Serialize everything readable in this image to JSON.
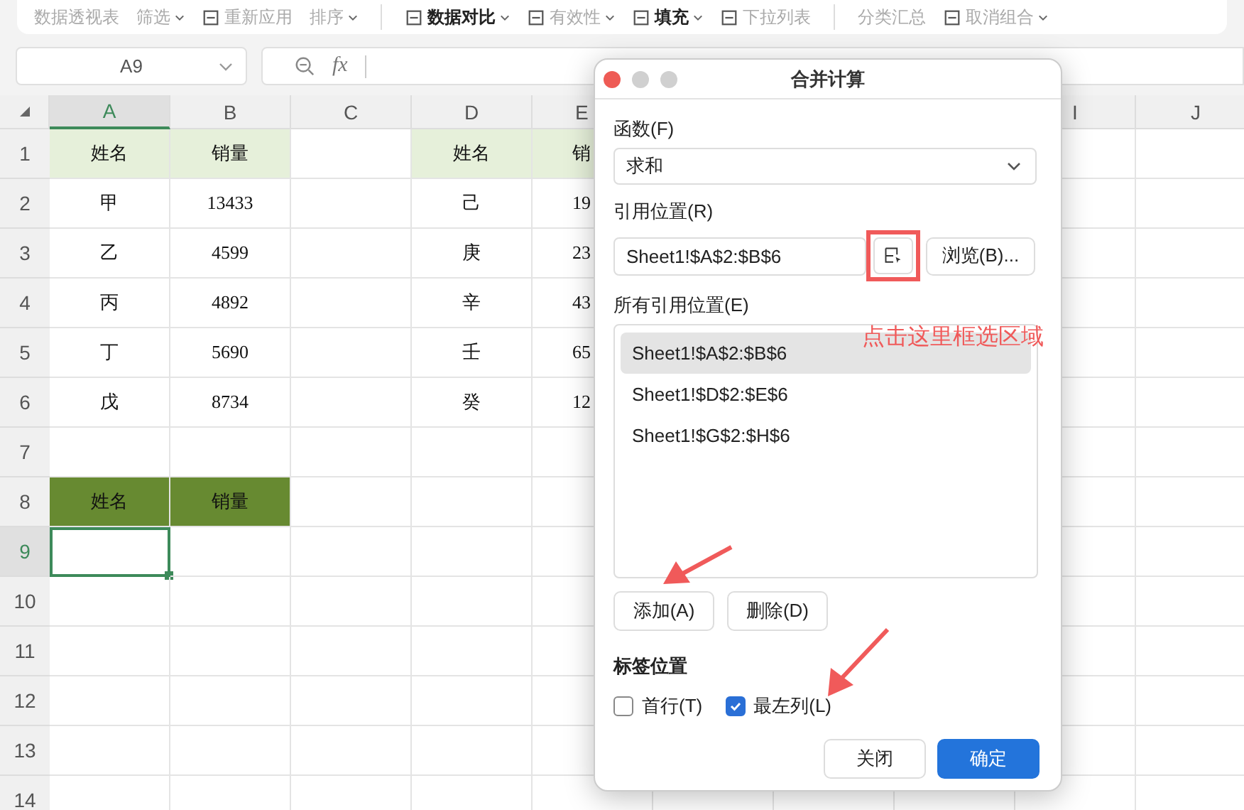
{
  "toolbar": {
    "groups": [
      [
        {
          "label": "数据透视表",
          "kind": "text",
          "dropdown": false
        },
        {
          "label": "筛选",
          "kind": "text",
          "dropdown": true
        },
        {
          "label": "重新应用",
          "kind": "icon",
          "dropdown": false
        },
        {
          "label": "排序",
          "kind": "text",
          "dropdown": true
        }
      ],
      [
        {
          "label": "数据对比",
          "kind": "icon",
          "dropdown": true,
          "bold": true
        },
        {
          "label": "有效性",
          "kind": "icon",
          "dropdown": true,
          "bold": false
        },
        {
          "label": "填充",
          "kind": "icon",
          "dropdown": true,
          "bold": true
        },
        {
          "label": "下拉列表",
          "kind": "icon",
          "dropdown": false,
          "bold": false
        }
      ],
      [
        {
          "label": "分类汇总",
          "kind": "text",
          "dropdown": false
        },
        {
          "label": "取消组合",
          "kind": "icon",
          "dropdown": true
        }
      ]
    ]
  },
  "formula_bar": {
    "name_box": "A9",
    "fx": "fx"
  },
  "sheet": {
    "columns": [
      {
        "label": "A",
        "selected": true
      },
      {
        "label": "B",
        "selected": false
      },
      {
        "label": "C",
        "selected": false
      },
      {
        "label": "D",
        "selected": false
      },
      {
        "label": "E",
        "selected": false
      },
      {},
      {},
      {},
      {
        "label": "I",
        "selected": false
      },
      {
        "label": "J",
        "selected": false
      }
    ],
    "rows": [
      {
        "label": "1",
        "selected": false,
        "cells": [
          {
            "text": "姓名",
            "color": "#e6f0da"
          },
          {
            "text": "销量",
            "color": "#e6f0da"
          },
          {
            "text": ""
          },
          {
            "text": "姓名",
            "color": "#e6f0da"
          },
          {
            "text": "销",
            "color": "#e6f0da"
          }
        ]
      },
      {
        "label": "2",
        "selected": false,
        "cells": [
          {
            "text": "甲"
          },
          {
            "text": "13433"
          },
          {
            "text": ""
          },
          {
            "text": "己"
          },
          {
            "text": "19"
          }
        ]
      },
      {
        "label": "3",
        "selected": false,
        "cells": [
          {
            "text": "乙"
          },
          {
            "text": "4599"
          },
          {
            "text": ""
          },
          {
            "text": "庚"
          },
          {
            "text": "23"
          }
        ]
      },
      {
        "label": "4",
        "selected": false,
        "cells": [
          {
            "text": "丙"
          },
          {
            "text": "4892"
          },
          {
            "text": ""
          },
          {
            "text": "辛"
          },
          {
            "text": "43"
          }
        ]
      },
      {
        "label": "5",
        "selected": false,
        "cells": [
          {
            "text": "丁"
          },
          {
            "text": "5690"
          },
          {
            "text": ""
          },
          {
            "text": "壬"
          },
          {
            "text": "65"
          }
        ]
      },
      {
        "label": "6",
        "selected": false,
        "cells": [
          {
            "text": "戊"
          },
          {
            "text": "8734"
          },
          {
            "text": ""
          },
          {
            "text": "癸"
          },
          {
            "text": "12"
          }
        ]
      },
      {
        "label": "7",
        "selected": false,
        "cells": []
      },
      {
        "label": "8",
        "selected": false,
        "cells": [
          {
            "text": "姓名",
            "color": "#678a31"
          },
          {
            "text": "销量",
            "color": "#678a31"
          }
        ]
      },
      {
        "label": "9",
        "selected": true,
        "cells": [
          {
            "text": "",
            "selected": true
          }
        ]
      },
      {
        "label": "10",
        "selected": false,
        "cells": []
      },
      {
        "label": "11",
        "selected": false,
        "cells": []
      },
      {
        "label": "12",
        "selected": false,
        "cells": []
      },
      {
        "label": "13",
        "selected": false,
        "cells": []
      },
      {
        "label": "14",
        "selected": false,
        "cells": []
      }
    ]
  },
  "dialog": {
    "title": "合并计算",
    "function": {
      "label": "函数(F)",
      "value": "求和"
    },
    "reference": {
      "label": "引用位置(R)",
      "value": "Sheet1!$A$2:$B$6",
      "browse_button": "浏览(B)..."
    },
    "all_references": {
      "label": "所有引用位置(E)",
      "items": [
        {
          "text": "Sheet1!$A$2:$B$6",
          "selected": true
        },
        {
          "text": "Sheet1!$D$2:$E$6",
          "selected": false
        },
        {
          "text": "Sheet1!$G$2:$H$6",
          "selected": false
        }
      ]
    },
    "add_button": "添加(A)",
    "delete_button": "删除(D)",
    "label_position": {
      "label": "标签位置",
      "options": [
        {
          "label": "首行(T)",
          "checked": false
        },
        {
          "label": "最左列(L)",
          "checked": true
        }
      ]
    },
    "buttons": [
      {
        "label": "关闭",
        "primary": false
      },
      {
        "label": "确定",
        "primary": true
      }
    ]
  },
  "annotation": {
    "text": "点击这里框选区域"
  }
}
